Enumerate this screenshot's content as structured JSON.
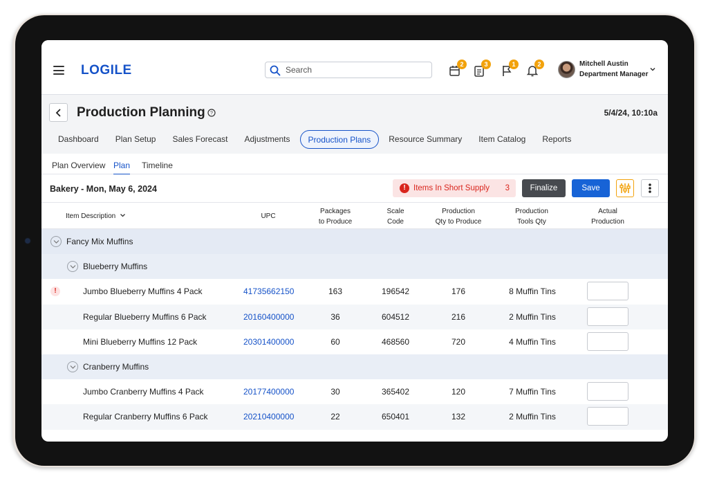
{
  "colors": {
    "brand": "#1552c8",
    "badge": "#f2a20c",
    "alert": "#d9251d",
    "save": "#1763d6",
    "finalize": "#474a4f"
  },
  "header": {
    "logo": "LOGILE",
    "search_placeholder": "Search",
    "badges": [
      {
        "icon": "calendar-icon",
        "count": "2"
      },
      {
        "icon": "clipboard-icon",
        "count": "3"
      },
      {
        "icon": "flag-icon",
        "count": "1"
      },
      {
        "icon": "bell-icon",
        "count": "2"
      }
    ],
    "user": {
      "name": "Mitchell Austin",
      "role": "Department Manager"
    }
  },
  "page": {
    "title": "Production Planning",
    "timestamp": "5/4/24, 10:10a",
    "tabs": [
      "Dashboard",
      "Plan Setup",
      "Sales Forecast",
      "Adjustments",
      "Production Plans",
      "Resource Summary",
      "Item Catalog",
      "Reports"
    ],
    "active_tab": "Production Plans",
    "sub_tabs": [
      "Plan Overview",
      "Plan",
      "Timeline"
    ],
    "active_sub_tab": "Plan"
  },
  "toolbar": {
    "plan_label": "Bakery - Mon, May 6, 2024",
    "short_supply_label": "Items In Short Supply",
    "short_supply_count": "3",
    "finalize_label": "Finalize",
    "save_label": "Save"
  },
  "table": {
    "headers": {
      "item": "Item Description",
      "upc": "UPC",
      "packages_1": "Packages",
      "packages_2": "to Produce",
      "scale_1": "Scale",
      "scale_2": "Code",
      "prodqty_1": "Production",
      "prodqty_2": "Qty to Produce",
      "tools_1": "Production",
      "tools_2": "Tools Qty",
      "actual_1": "Actual",
      "actual_2": "Production"
    },
    "group": "Fancy Mix Muffins",
    "subgroups": [
      {
        "name": "Blueberry Muffins",
        "items": [
          {
            "desc": "Jumbo Blueberry Muffins 4 Pack",
            "upc": "41735662150",
            "packages": "163",
            "scale": "196542",
            "qty": "176",
            "tools": "8 Muffin Tins",
            "actual": "",
            "alert": true
          },
          {
            "desc": "Regular Blueberry Muffins 6 Pack",
            "upc": "20160400000",
            "packages": "36",
            "scale": "604512",
            "qty": "216",
            "tools": "2 Muffin Tins",
            "actual": "",
            "alert": false
          },
          {
            "desc": "Mini Blueberry Muffins 12 Pack",
            "upc": "20301400000",
            "packages": "60",
            "scale": "468560",
            "qty": "720",
            "tools": "4 Muffin Tins",
            "actual": "",
            "alert": false
          }
        ]
      },
      {
        "name": "Cranberry Muffins",
        "items": [
          {
            "desc": "Jumbo Cranberry Muffins 4 Pack",
            "upc": "20177400000",
            "packages": "30",
            "scale": "365402",
            "qty": "120",
            "tools": "7 Muffin Tins",
            "actual": "",
            "alert": false
          },
          {
            "desc": "Regular Cranberry Muffins 6 Pack",
            "upc": "20210400000",
            "packages": "22",
            "scale": "650401",
            "qty": "132",
            "tools": "2 Muffin Tins",
            "actual": "",
            "alert": false
          }
        ]
      }
    ]
  }
}
